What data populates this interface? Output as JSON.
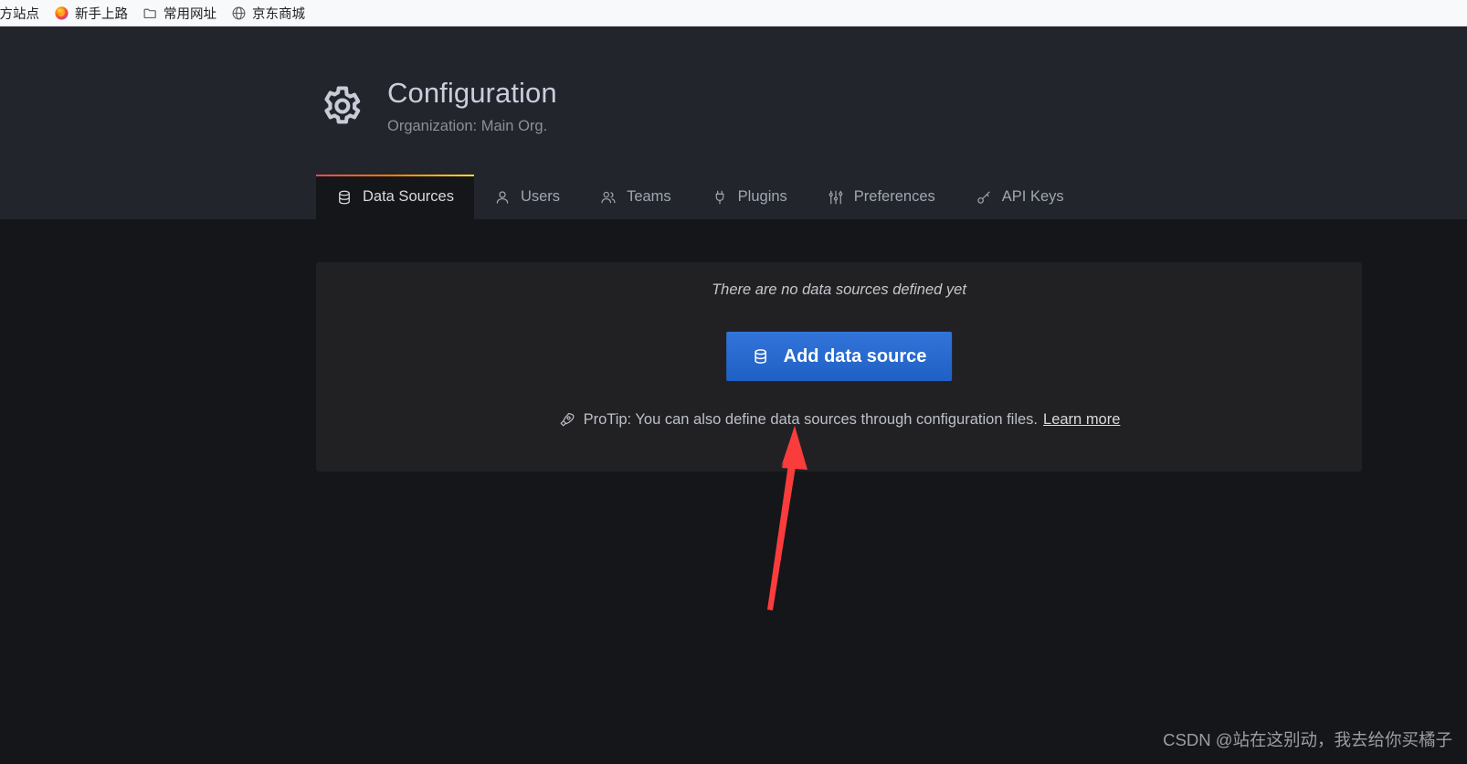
{
  "browser": {
    "bookmarks": [
      {
        "label": "官方站点",
        "icon": "globe-icon"
      },
      {
        "label": "新手上路",
        "icon": "firefox-icon"
      },
      {
        "label": "常用网址",
        "icon": "folder-icon"
      },
      {
        "label": "京东商城",
        "icon": "globe-icon"
      }
    ]
  },
  "header": {
    "icon": "gear-icon",
    "title": "Configuration",
    "subtitle": "Organization: Main Org."
  },
  "tabs": [
    {
      "label": "Data Sources",
      "icon": "database-icon",
      "active": true
    },
    {
      "label": "Users",
      "icon": "user-icon",
      "active": false
    },
    {
      "label": "Teams",
      "icon": "users-icon",
      "active": false
    },
    {
      "label": "Plugins",
      "icon": "plug-icon",
      "active": false
    },
    {
      "label": "Preferences",
      "icon": "sliders-icon",
      "active": false
    },
    {
      "label": "API Keys",
      "icon": "key-icon",
      "active": false
    }
  ],
  "panel": {
    "empty_message": "There are no data sources defined yet",
    "add_button": {
      "label": "Add data source",
      "icon": "database-icon",
      "color": "#3274d9"
    },
    "protip": {
      "icon": "rocket-icon",
      "text": "ProTip: You can also define data sources through configuration files.",
      "link_label": "Learn more"
    }
  },
  "annotation": {
    "arrow_color": "#fa3c3c",
    "points_to": "Add data source"
  },
  "watermark": {
    "text": "CSDN @站在这别动，我去给你买橘子"
  },
  "theme": {
    "page_background": "#141619",
    "header_background": "#22252b",
    "panel_background": "#212124",
    "accent_gradient_start": "#f2495c",
    "accent_gradient_end": "#fade2a",
    "primary_text": "#ccccdc",
    "secondary_text": "#8e8e9a"
  }
}
